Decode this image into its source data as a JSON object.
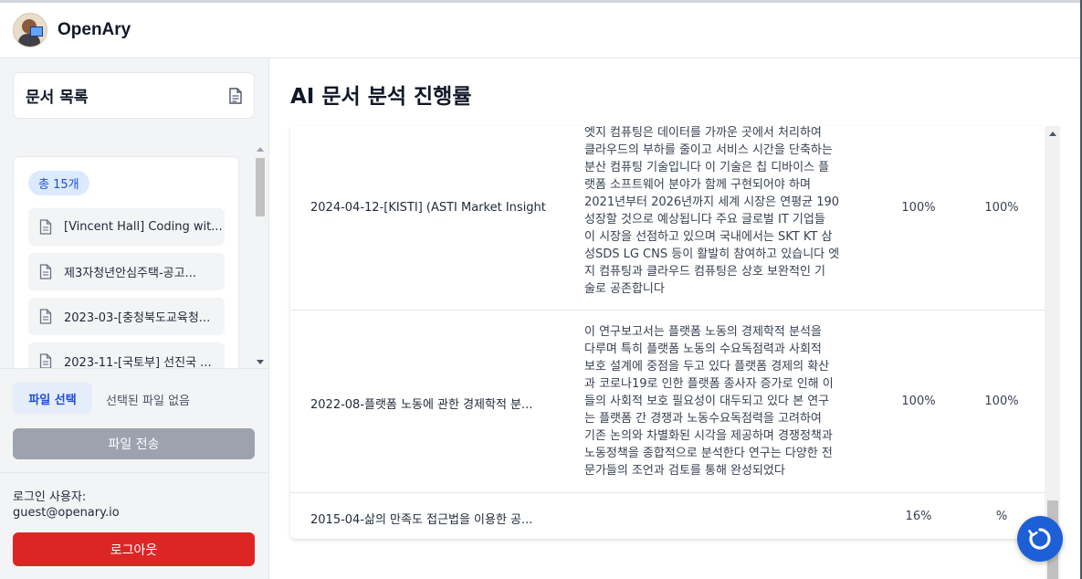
{
  "app": {
    "name": "OpenAry",
    "avatar_icon": "user-avatar"
  },
  "sidebar": {
    "header_title": "문서 목록",
    "header_icon": "document-icon",
    "count_badge": "총 15개",
    "items": [
      {
        "label": "[Vincent Hall] Coding wit..."
      },
      {
        "label": "제3자청년안심주택-공고..."
      },
      {
        "label": "2023-03-[충청북도교육청..."
      },
      {
        "label": "2023-11-[국토부] 선진국 ..."
      }
    ],
    "file_select_label": "파일 선택",
    "no_file_label": "선택된 파일 없음",
    "send_label": "파일 전송",
    "login_label": "로그인 사용자:",
    "login_email": "guest@openary.io",
    "logout_label": "로그아웃"
  },
  "main": {
    "title": "AI 문서 분석 진행률",
    "rows": [
      {
        "name": "2024-04-12-[KISTI] (ASTI Market Insight ...",
        "summary": [
          "엣지 컴퓨팅은 데이터를 가까운 곳에서 처리하여",
          "클라우드의 부하를 줄이고 서비스 시간을 단축하는",
          "분산 컴퓨팅 기술입니다 이 기술은 칩 디바이스 플",
          "랫폼 소프트웨어 분야가 함께 구현되어야 하며",
          "2021년부터 2026년까지 세계 시장은 연평균 190",
          "성장할 것으로 예상됩니다 주요 글로벌 IT 기업들",
          "이 시장을 선점하고 있으며 국내에서는 SKT KT 삼",
          "성SDS LG CNS 등이 활발히 참여하고 있습니다 엣",
          "지 컴퓨팅과 클라우드 컴퓨팅은 상호 보완적인 기",
          "술로 공존합니다"
        ],
        "progress1": "100%",
        "progress2": "100%"
      },
      {
        "name": "2022-08-플랫폼 노동에 관한 경제학적 분...",
        "summary": [
          "이 연구보고서는 플랫폼 노동의 경제학적 분석을",
          "다루며 특히 플랫폼 노동의 수요독점력과 사회적",
          "보호 설계에 중점을 두고 있다 플랫폼 경제의 확산",
          "과 코로나19로 인한 플랫폼 종사자 증가로 인해 이",
          "들의 사회적 보호 필요성이 대두되고 있다 본 연구",
          "는 플랫폼 간 경쟁과 노동수요독점력을 고려하여",
          "기존 논의와 차별화된 시각을 제공하며 경쟁정책과",
          "노동정책을 종합적으로 분석한다 연구는 다양한 전",
          "문가들의 조언과 검토를 통해 완성되었다"
        ],
        "progress1": "100%",
        "progress2": "100%"
      },
      {
        "name": "2015-04-삶의 만족도 접근법을 이용한 공...",
        "summary": [],
        "progress1": "16%",
        "progress2": "%"
      }
    ],
    "fab_icon": "refresh-icon"
  }
}
